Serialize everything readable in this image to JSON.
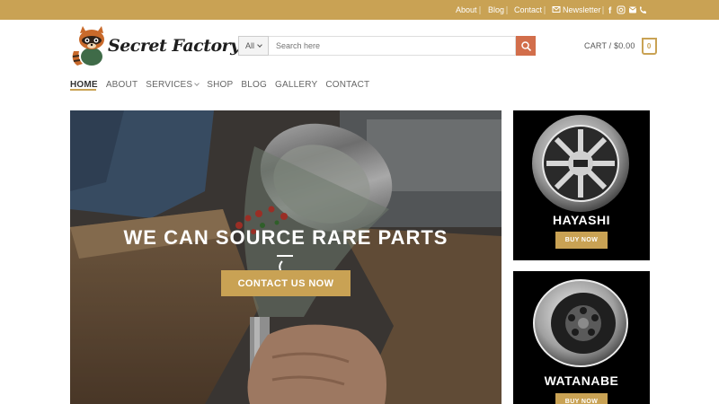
{
  "topbar": {
    "links": [
      "About",
      "Blog",
      "Contact"
    ],
    "newsletter_label": "Newsletter",
    "social_icons": [
      "facebook-icon",
      "instagram-icon",
      "email-icon",
      "phone-icon"
    ],
    "color": "#c9a254"
  },
  "header": {
    "logo_text": "Secret Factory",
    "search_category": "All",
    "search_placeholder": "Search here",
    "cart_label": "CART / $0.00",
    "cart_count": "0",
    "search_button_color": "#d26e4b"
  },
  "nav": {
    "items": [
      "HOME",
      "ABOUT",
      "SERVICES",
      "SHOP",
      "BLOG",
      "GALLERY",
      "CONTACT"
    ],
    "active": "HOME"
  },
  "hero": {
    "title": "WE CAN SOURCE RARE PARTS",
    "button_label": "CONTACT US NOW"
  },
  "promos": [
    {
      "title": "HAYASHI",
      "button_label": "BUY NOW"
    },
    {
      "title": "WATANABE",
      "button_label": "BUY NOW"
    }
  ],
  "colors": {
    "accent": "#c9a254",
    "text": "#444444",
    "promo_bg": "#000000"
  }
}
